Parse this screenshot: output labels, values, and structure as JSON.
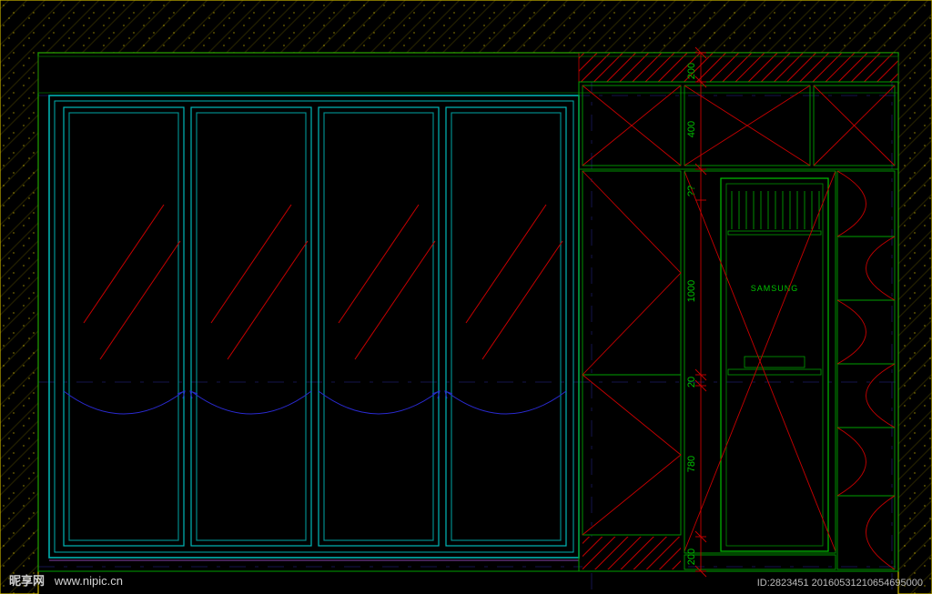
{
  "dimensions": {
    "top_cabinet_inset": "200",
    "top_cabinet": "400",
    "upper_section": "1000",
    "shelf_gap": "20",
    "lower_section": "780",
    "bottom_plinth": "200",
    "clearance_note": "??"
  },
  "appliance": {
    "brand": "SAMSUNG"
  },
  "watermark": {
    "site_cn": "昵享网",
    "site_url": "www.nipic.cn",
    "meta_id": "ID:2823451  20160531210654695000"
  },
  "legend": {
    "door_panels": 4
  }
}
